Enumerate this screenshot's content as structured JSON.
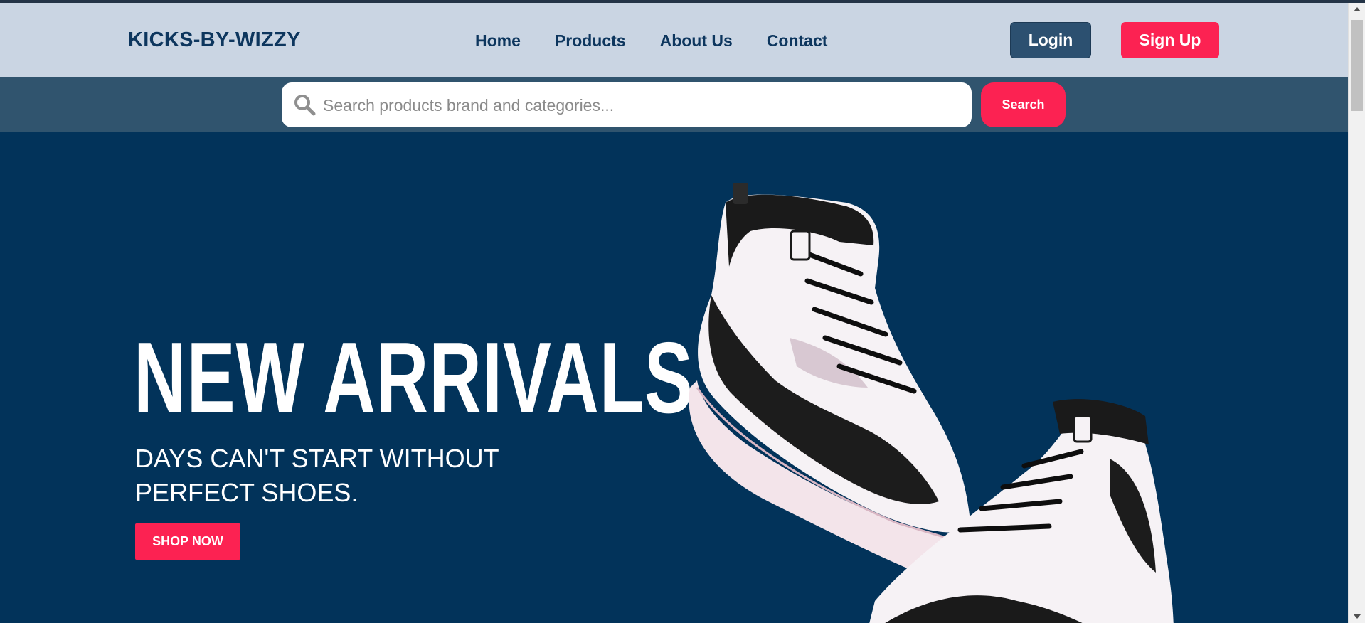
{
  "brand": {
    "logo_text": "KICKS-BY-WIZZY"
  },
  "nav": {
    "items": [
      {
        "label": "Home"
      },
      {
        "label": "Products"
      },
      {
        "label": "About Us"
      },
      {
        "label": "Contact"
      }
    ]
  },
  "auth": {
    "login_label": "Login",
    "signup_label": "Sign Up"
  },
  "search": {
    "placeholder": "Search products brand and categories...",
    "value": "",
    "button_label": "Search",
    "icon": "search-icon"
  },
  "hero": {
    "title": "NEW ARRIVALS",
    "subtitle": "DAYS CAN'T START WITHOUT PERFECT SHOES.",
    "cta_label": "SHOP NOW",
    "image": "sneaker-pair-image"
  },
  "colors": {
    "header_bg": "#cad5e3",
    "searchbar_bg": "#30546e",
    "hero_bg": "#02335a",
    "accent": "#fc2252",
    "login_bg": "#2c5070",
    "brand_text": "#0d365e"
  }
}
